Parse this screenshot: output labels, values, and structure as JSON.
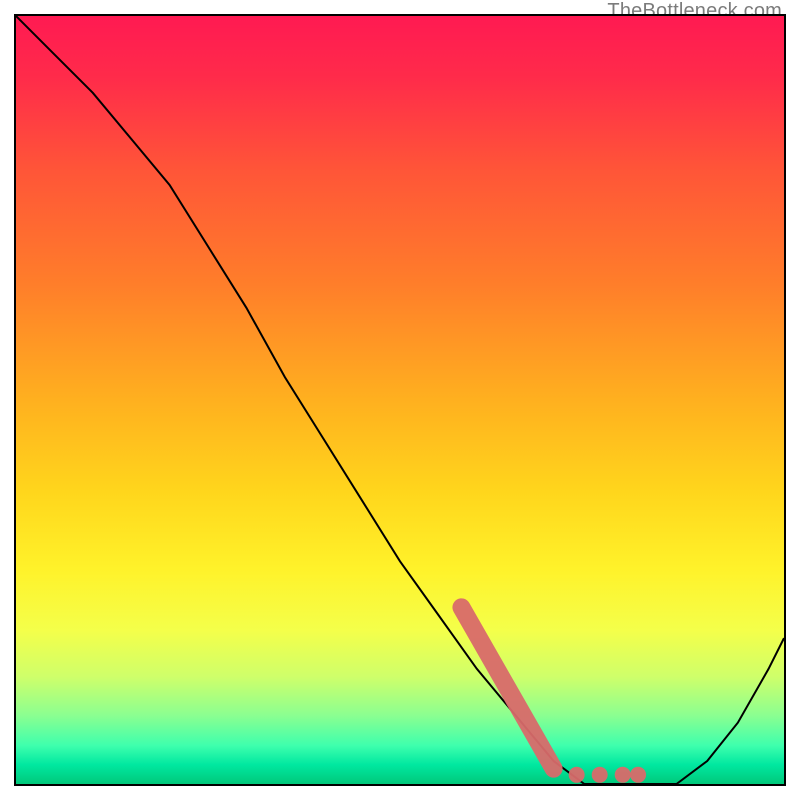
{
  "watermark": "TheBottleneck.com",
  "chart_data": {
    "type": "line",
    "title": "",
    "xlabel": "",
    "ylabel": "",
    "xlim": [
      0,
      100
    ],
    "ylim": [
      0,
      100
    ],
    "grid": false,
    "legend": false,
    "series": [
      {
        "name": "curve",
        "color": "#000000",
        "x": [
          0,
          5,
          10,
          15,
          20,
          25,
          30,
          35,
          40,
          45,
          50,
          55,
          60,
          65,
          70,
          74,
          78,
          82,
          86,
          90,
          94,
          98,
          100
        ],
        "y": [
          100,
          95,
          90,
          84,
          78,
          70,
          62,
          53,
          45,
          37,
          29,
          22,
          15,
          9,
          3,
          0,
          0,
          0,
          0,
          3,
          8,
          15,
          19
        ]
      }
    ],
    "highlight_region": {
      "name": "optimal-zone",
      "color": "#d86a6a",
      "points": [
        {
          "x": 58,
          "y": 23
        },
        {
          "x": 70,
          "y": 2
        },
        {
          "x": 73,
          "y": 1.2
        },
        {
          "x": 76,
          "y": 1.2
        },
        {
          "x": 79,
          "y": 1.2
        },
        {
          "x": 81,
          "y": 1.2
        }
      ]
    },
    "background_gradient": {
      "stops": [
        {
          "offset": 0.0,
          "color": "#ff1a52"
        },
        {
          "offset": 0.08,
          "color": "#ff2b4a"
        },
        {
          "offset": 0.2,
          "color": "#ff5538"
        },
        {
          "offset": 0.35,
          "color": "#ff7e2a"
        },
        {
          "offset": 0.5,
          "color": "#ffb01f"
        },
        {
          "offset": 0.62,
          "color": "#ffd61c"
        },
        {
          "offset": 0.72,
          "color": "#fff22a"
        },
        {
          "offset": 0.8,
          "color": "#f4ff4a"
        },
        {
          "offset": 0.86,
          "color": "#cfff6a"
        },
        {
          "offset": 0.91,
          "color": "#8cff90"
        },
        {
          "offset": 0.95,
          "color": "#3effad"
        },
        {
          "offset": 0.975,
          "color": "#00e8a0"
        },
        {
          "offset": 1.0,
          "color": "#00c87a"
        }
      ]
    }
  }
}
